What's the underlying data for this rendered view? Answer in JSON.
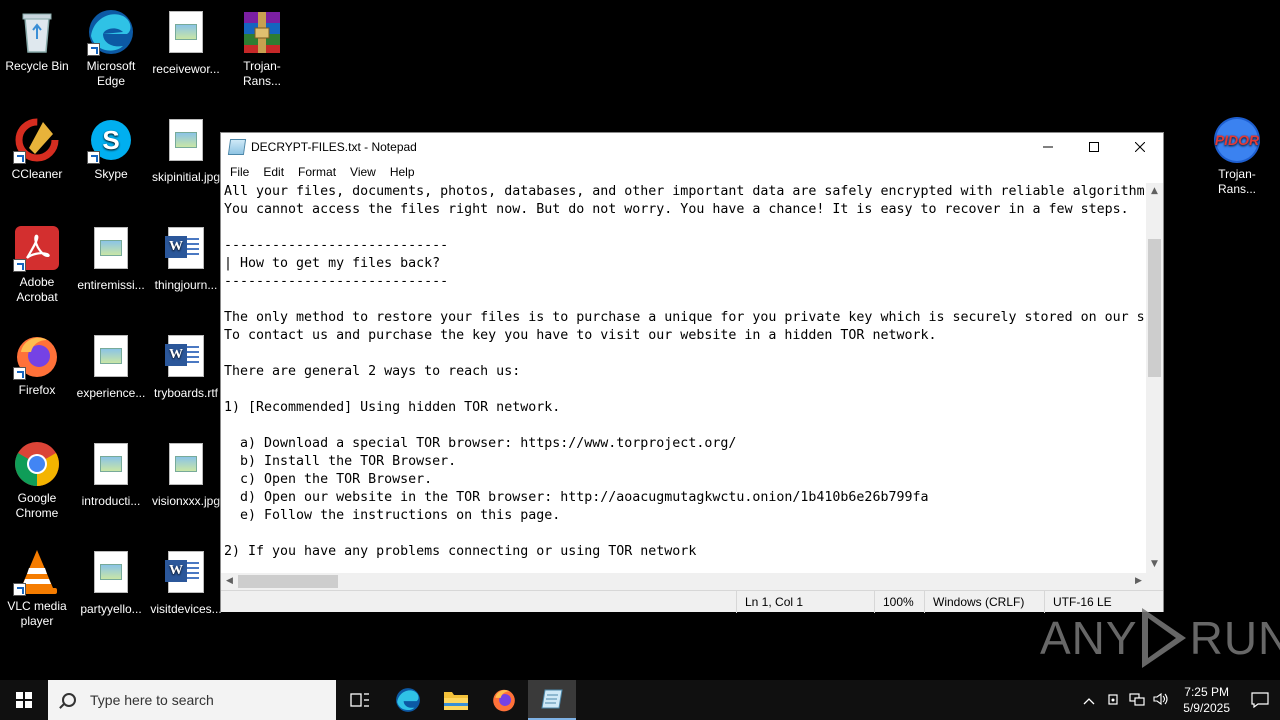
{
  "desktop": {
    "icons": [
      {
        "label": "Recycle Bin",
        "icon": "recycle-bin-icon"
      },
      {
        "label": "Microsoft Edge",
        "icon": "edge-icon"
      },
      {
        "label": "receivewor...",
        "icon": "image-file-icon"
      },
      {
        "label": "Trojan-Rans...",
        "icon": "winrar-archive-icon"
      },
      {
        "label": "CCleaner",
        "icon": "ccleaner-icon"
      },
      {
        "label": "Skype",
        "icon": "skype-icon"
      },
      {
        "label": "skipinitial.jpg",
        "icon": "image-file-icon"
      },
      {
        "label": "Trojan-Rans...",
        "icon": "pidor-ransomware-icon",
        "logo_text": "PIDOR"
      },
      {
        "label": "Adobe Acrobat",
        "icon": "acrobat-icon"
      },
      {
        "label": "entiremissi...",
        "icon": "image-file-icon"
      },
      {
        "label": "thingjourn...",
        "icon": "word-doc-icon"
      },
      {
        "label": "Firefox",
        "icon": "firefox-icon"
      },
      {
        "label": "experience...",
        "icon": "image-file-icon"
      },
      {
        "label": "tryboards.rtf",
        "icon": "word-doc-icon"
      },
      {
        "label": "Google Chrome",
        "icon": "chrome-icon"
      },
      {
        "label": "introducti...",
        "icon": "image-file-icon"
      },
      {
        "label": "visionxxx.jpg",
        "icon": "image-file-icon"
      },
      {
        "label": "VLC media player",
        "icon": "vlc-icon"
      },
      {
        "label": "partyyello...",
        "icon": "image-file-icon"
      },
      {
        "label": "visitdevices...",
        "icon": "word-doc-icon"
      }
    ]
  },
  "notepad": {
    "title": "DECRYPT-FILES.txt - Notepad",
    "menu": [
      "File",
      "Edit",
      "Format",
      "View",
      "Help"
    ],
    "lines": [
      "All your files, documents, photos, databases, and other important data are safely encrypted with reliable algorithm",
      "You cannot access the files right now. But do not worry. You have a chance! It is easy to recover in a few steps.",
      "",
      "----------------------------",
      "| How to get my files back?",
      "----------------------------",
      "",
      "The only method to restore your files is to purchase a unique for you private key which is securely stored on our s",
      "To contact us and purchase the key you have to visit our website in a hidden TOR network.",
      "",
      "There are general 2 ways to reach us:",
      "",
      "1) [Recommended] Using hidden TOR network.",
      "",
      "  a) Download a special TOR browser: https://www.torproject.org/",
      "  b) Install the TOR Browser.",
      "  c) Open the TOR Browser.",
      "  d) Open our website in the TOR browser: http://aoacugmutagkwctu.onion/1b410b6e26b799fa",
      "  e) Follow the instructions on this page.",
      "",
      "2) If you have any problems connecting or using TOR network"
    ],
    "status": {
      "position": "Ln 1, Col 1",
      "zoom": "100%",
      "line_endings": "Windows (CRLF)",
      "encoding": "UTF-16 LE"
    }
  },
  "watermark": {
    "left": "ANY",
    "right": "RUN"
  },
  "taskbar": {
    "search_placeholder": "Type here to search",
    "clock_time": "7:25 PM",
    "clock_date": "5/9/2025"
  },
  "colors": {
    "accent": "#0078d7",
    "taskbar": "#101010"
  }
}
